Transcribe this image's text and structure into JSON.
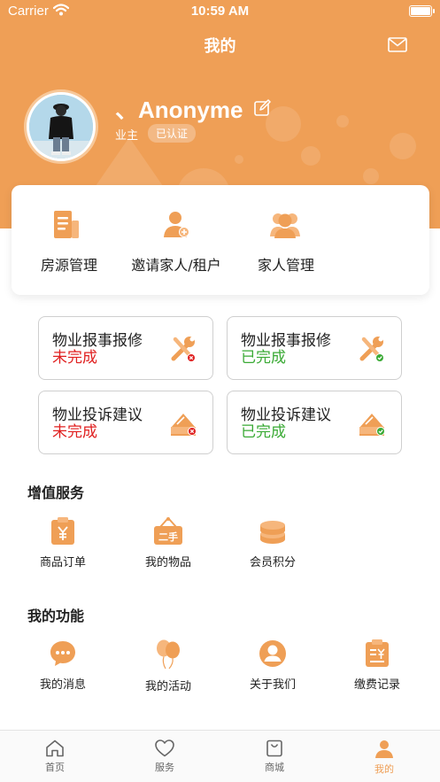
{
  "status_bar": {
    "carrier": "Carrier",
    "time": "10:59 AM"
  },
  "header": {
    "title": "我的"
  },
  "profile": {
    "name": "、Anonyme",
    "role": "业主",
    "badge": "已认证"
  },
  "quick_actions": [
    {
      "label": "房源管理",
      "icon": "building-doc-icon"
    },
    {
      "label": "邀请家人/租户",
      "icon": "add-person-icon"
    },
    {
      "label": "家人管理",
      "icon": "family-icon"
    }
  ],
  "status_cards": [
    {
      "title": "物业报事报修",
      "status": "未完成",
      "status_color": "#e02020",
      "icon": "repair-tools-icon"
    },
    {
      "title": "物业报事报修",
      "status": "已完成",
      "status_color": "#3aaa35",
      "icon": "repair-tools-icon"
    },
    {
      "title": "物业投诉建议",
      "status": "未完成",
      "status_color": "#e02020",
      "icon": "complaint-letter-icon"
    },
    {
      "title": "物业投诉建议",
      "status": "已完成",
      "status_color": "#3aaa35",
      "icon": "complaint-letter-icon"
    }
  ],
  "value_services": {
    "title": "增值服务",
    "items": [
      {
        "label": "商品订单",
        "icon": "yuan-order-icon"
      },
      {
        "label": "我的物品",
        "icon": "secondhand-sign-icon",
        "icon_text": "二手"
      },
      {
        "label": "会员积分",
        "icon": "coins-stack-icon"
      }
    ]
  },
  "my_functions": {
    "title": "我的功能",
    "items": [
      {
        "label": "我的消息",
        "icon": "chat-bubble-icon"
      },
      {
        "label": "我的活动",
        "icon": "balloons-icon"
      },
      {
        "label": "关于我们",
        "icon": "person-circle-icon"
      },
      {
        "label": "缴费记录",
        "icon": "clipboard-yuan-icon"
      }
    ]
  },
  "tabbar": [
    {
      "label": "首页",
      "icon": "home-icon",
      "active": false
    },
    {
      "label": "服务",
      "icon": "heart-icon",
      "active": false
    },
    {
      "label": "商城",
      "icon": "shopping-bag-icon",
      "active": false
    },
    {
      "label": "我的",
      "icon": "person-icon",
      "active": true
    }
  ],
  "colors": {
    "accent": "#ef9f56",
    "incomplete": "#e02020",
    "complete": "#3aaa35"
  }
}
